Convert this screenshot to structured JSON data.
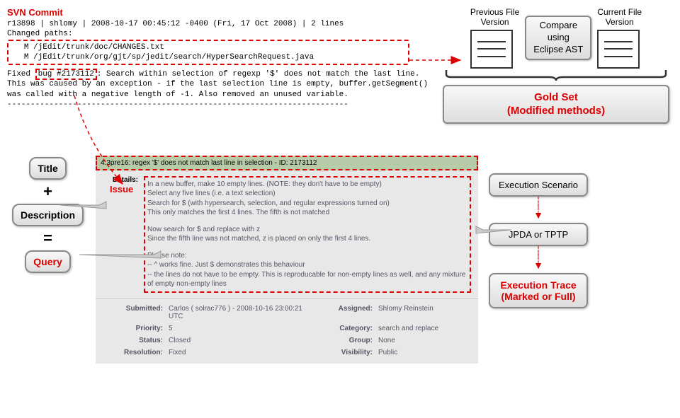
{
  "svn": {
    "label": "SVN Commit",
    "header_line": "r13898 | shlomy | 2008-10-17 00:45:12 -0400 (Fri, 17 Oct 2008) | 2 lines",
    "changed_paths_label": "Changed paths:",
    "paths": [
      "M /jEdit/trunk/doc/CHANGES.txt",
      "M /jEdit/trunk/org/gjt/sp/jedit/search/HyperSearchRequest.java"
    ],
    "message_prefix": "Fixed ",
    "bug_ref": "bug #2173112",
    "message_rest": ": Search within selection of regexp '$' does not match the last line. This was caused by an exception - if the last selection line is empty, buffer.getSegment() was called with a negative length of -1. Also removed an unused variable.",
    "dashline": "-------------------------------------------------------------------------"
  },
  "compare": {
    "prev_label": "Previous File\nVersion",
    "curr_label": "Current File\nVersion",
    "compare_text": "Compare\nusing\nEclipse AST",
    "gold_text": "Gold Set\n(Modified methods)"
  },
  "issue_label": "Issue",
  "left_labels": {
    "title": "Title",
    "plus": "+",
    "description": "Description",
    "eq": "=",
    "query": "Query"
  },
  "issue": {
    "title_text": "4.3pre16: regex '$' does not match last line in selection - ID: 2173112",
    "details_label": "Details:",
    "details_body_1": "In a new buffer, make 10 empty lines. (NOTE: they don't have to be empty)\nSelect any five lines (i.e. a text selection)\nSearch for $ (with hypersearch, selection, and regular expressions turned on)\nThis only matches the first 4 lines. The fifth is not matched",
    "details_body_2": "Now search for $ and replace with z\nSince the fifth line was not matched, z is placed on only the first 4 lines.",
    "details_body_3": "Please note:\n-- ^ works fine. Just $ demonstrates this behaviour\n-- the lines do not have to be empty. This is reproducable for non-empty lines as well, and any mixture of empty non-empty lines",
    "meta": {
      "submitted_k": "Submitted:",
      "submitted_v": "Carlos ( solrac776 ) - 2008-10-16 23:00:21 UTC",
      "assigned_k": "Assigned:",
      "assigned_v": "Shlomy Reinstein",
      "priority_k": "Priority:",
      "priority_v": "5",
      "category_k": "Category:",
      "category_v": "search and replace",
      "status_k": "Status:",
      "status_v": "Closed",
      "group_k": "Group:",
      "group_v": "None",
      "resolution_k": "Resolution:",
      "resolution_v": "Fixed",
      "visibility_k": "Visibility:",
      "visibility_v": "Public"
    }
  },
  "flow": {
    "exec_scenario": "Execution Scenario",
    "jpda": "JPDA or TPTP",
    "exec_trace": "Execution Trace\n(Marked or Full)"
  }
}
